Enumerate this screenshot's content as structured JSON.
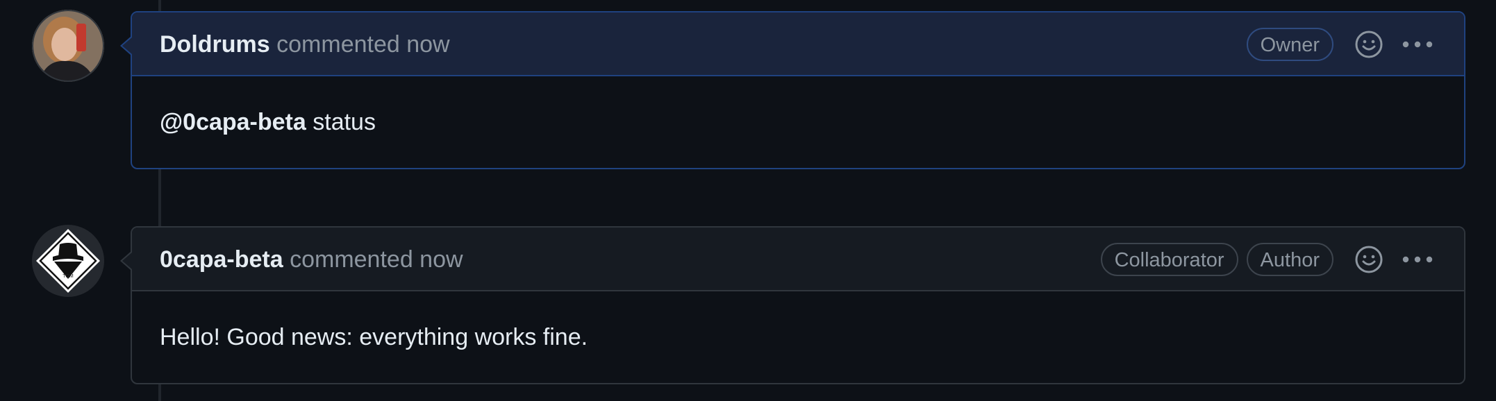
{
  "comments": [
    {
      "author": "Doldrums",
      "meta": "commented now",
      "badges": [
        "Owner"
      ],
      "mention": "@0capa-beta",
      "body": " status"
    },
    {
      "author": "0capa-beta",
      "meta": "commented now",
      "badges": [
        "Collaborator",
        "Author"
      ],
      "body": "Hello! Good news: everything works fine."
    }
  ],
  "avatars": {
    "tom_logo_text": "TOM"
  },
  "colors": {
    "background": "#0d1117",
    "owner_border": "#1f4280",
    "owner_header": "#1a243c",
    "default_header": "#161b22",
    "border": "#30363d",
    "muted_text": "#8d96a0"
  },
  "icons": {
    "reaction": "smiley-icon",
    "more": "kebab-horizontal-icon"
  }
}
